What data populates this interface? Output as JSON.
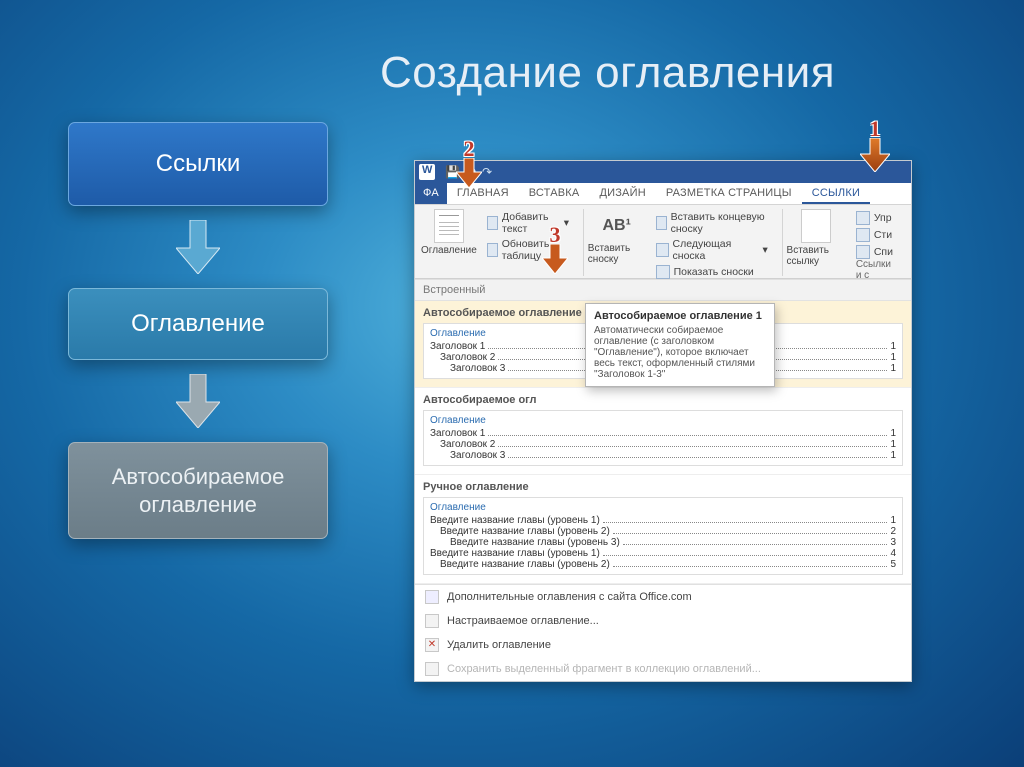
{
  "slide": {
    "title": "Создание оглавления"
  },
  "flow": {
    "box1": "Ссылки",
    "box2": "Оглавление",
    "box3": "Автособираемое оглавление"
  },
  "ribbon": {
    "tabs": {
      "file": "ФА",
      "home": "ГЛАВНАЯ",
      "insert": "ВСТАВКА",
      "design": "ДИЗАЙН",
      "layout": "РАЗМЕТКА СТРАНИЦЫ",
      "references": "ССЫЛКИ"
    },
    "groups": {
      "toc": {
        "big_label": "Оглавление",
        "add_text": "Добавить текст",
        "update_table": "Обновить таблицу"
      },
      "footnote": {
        "big_label": "Вставить сноску",
        "big_short": "AB¹",
        "insert_endnote": "Вставить концевую сноску",
        "next_footnote": "Следующая сноска",
        "show_notes": "Показать сноски"
      },
      "links": {
        "big_label": "Вставить ссылку",
        "upr": "Упр",
        "sti": "Сти",
        "spi": "Спи",
        "caption": "Ссылки и с"
      }
    }
  },
  "dropdown": {
    "header": "Встроенный",
    "styles": {
      "auto1": {
        "title": "Автособираемое оглавление 1",
        "preview_title": "Оглавление",
        "rows": [
          {
            "name": "Заголовок 1",
            "page": "1",
            "level": 1
          },
          {
            "name": "Заголовок 2",
            "page": "1",
            "level": 2
          },
          {
            "name": "Заголовок 3",
            "page": "1",
            "level": 3
          }
        ]
      },
      "auto2": {
        "title": "Автособираемое огл",
        "preview_title": "Оглавление",
        "rows": [
          {
            "name": "Заголовок 1",
            "page": "1",
            "level": 1
          },
          {
            "name": "Заголовок 2",
            "page": "1",
            "level": 2
          },
          {
            "name": "Заголовок 3",
            "page": "1",
            "level": 3
          }
        ]
      },
      "manual": {
        "title": "Ручное оглавление",
        "preview_title": "Оглавление",
        "rows": [
          {
            "name": "Введите название главы (уровень 1)",
            "page": "1",
            "level": 1
          },
          {
            "name": "Введите название главы (уровень 2)",
            "page": "2",
            "level": 2
          },
          {
            "name": "Введите название главы (уровень 3)",
            "page": "3",
            "level": 3
          },
          {
            "name": "Введите название главы (уровень 1)",
            "page": "4",
            "level": 1
          },
          {
            "name": "Введите название главы (уровень 2)",
            "page": "5",
            "level": 2
          }
        ]
      }
    },
    "tooltip": {
      "title": "Автособираемое оглавление 1",
      "body": "Автоматически собираемое оглавление (с заголовком \"Оглавление\"), которое включает весь текст, оформленный стилями \"Заголовок 1-3\""
    },
    "footer": {
      "office": "Дополнительные оглавления с сайта Office.com",
      "custom": "Настраиваемое оглавление...",
      "remove": "Удалить оглавление",
      "save": "Сохранить выделенный фрагмент в коллекцию оглавлений..."
    }
  },
  "callouts": {
    "n1": "1",
    "n2": "2",
    "n3": "3"
  }
}
